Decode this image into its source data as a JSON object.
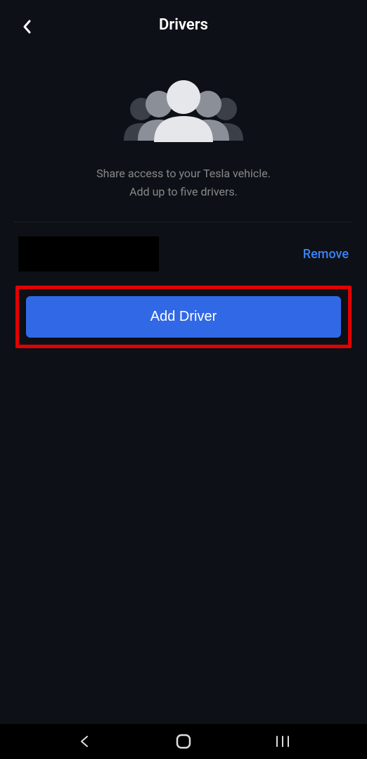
{
  "header": {
    "title": "Drivers"
  },
  "hero": {
    "line1": "Share access to your Tesla vehicle.",
    "line2": "Add up to five drivers."
  },
  "drivers": [
    {
      "name": "",
      "remove_label": "Remove"
    }
  ],
  "actions": {
    "add_driver_label": "Add Driver"
  }
}
